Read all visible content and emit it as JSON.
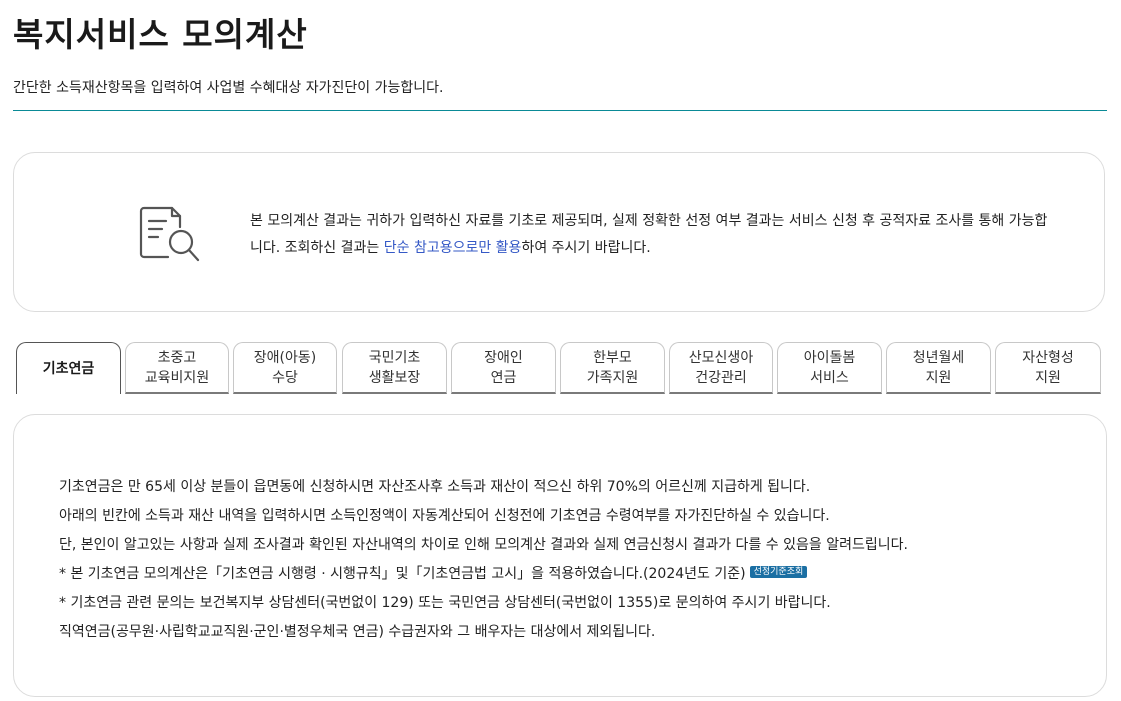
{
  "header": {
    "title": "복지서비스 모의계산",
    "description": "간단한 소득재산항목을 입력하여 사업별 수혜대상 자가진단이 가능합니다."
  },
  "notice": {
    "icon": "document-search-icon",
    "text_before": "본 모의계산 결과는 귀하가 입력하신 자료를 기초로 제공되며, 실제 정확한 선정 여부 결과는 서비스 신청 후 공적자료 조사를 통해 가능합니다. 조회하신 결과는 ",
    "text_highlight": "단순 참고용으로만 활용",
    "text_after": "하여 주시기 바랍니다.",
    "highlight_color": "#3559c6"
  },
  "tabs": [
    {
      "label": "기초연금",
      "active": true
    },
    {
      "label": "초중고\n교육비지원",
      "active": false
    },
    {
      "label": "장애(아동)\n수당",
      "active": false
    },
    {
      "label": "국민기초\n생활보장",
      "active": false
    },
    {
      "label": "장애인\n연금",
      "active": false
    },
    {
      "label": "한부모\n가족지원",
      "active": false
    },
    {
      "label": "산모신생아\n건강관리",
      "active": false
    },
    {
      "label": "아이돌봄\n서비스",
      "active": false
    },
    {
      "label": "청년월세\n지원",
      "active": false
    },
    {
      "label": "자산형성\n지원",
      "active": false
    }
  ],
  "content": {
    "line1": "기초연금은 만 65세 이상 분들이 읍면동에 신청하시면 자산조사후 소득과 재산이 적으신 하위 70%의 어르신께 지급하게 됩니다.",
    "line2": "아래의 빈칸에 소득과 재산 내역을 입력하시면 소득인정액이 자동계산되어 신청전에 기초연금 수령여부를 자가진단하실 수 있습니다.",
    "line3": "단, 본인이 알고있는 사항과 실제 조사결과 확인된 자산내역의 차이로 인해 모의계산 결과와 실제 연금신청시 결과가 다를 수 있음을 알려드립니다.",
    "line4": "* 본 기초연금 모의계산은「기초연금 시행령 · 시행규칙」및「기초연금법 고시」을 적용하였습니다.(2024년도 기준)",
    "badge": "선정기준조회",
    "line5": "* 기초연금 관련 문의는 보건복지부 상담센터(국번없이 129) 또는 국민연금 상담센터(국번없이 1355)로 문의하여 주시기 바랍니다.",
    "line6": "직역연금(공무원·사립학교교직원·군인·별정우체국 연금) 수급권자와 그 배우자는 대상에서 제외됩니다."
  },
  "colors": {
    "rule": "#0a8a96",
    "badge_bg": "#1b6fa3"
  }
}
